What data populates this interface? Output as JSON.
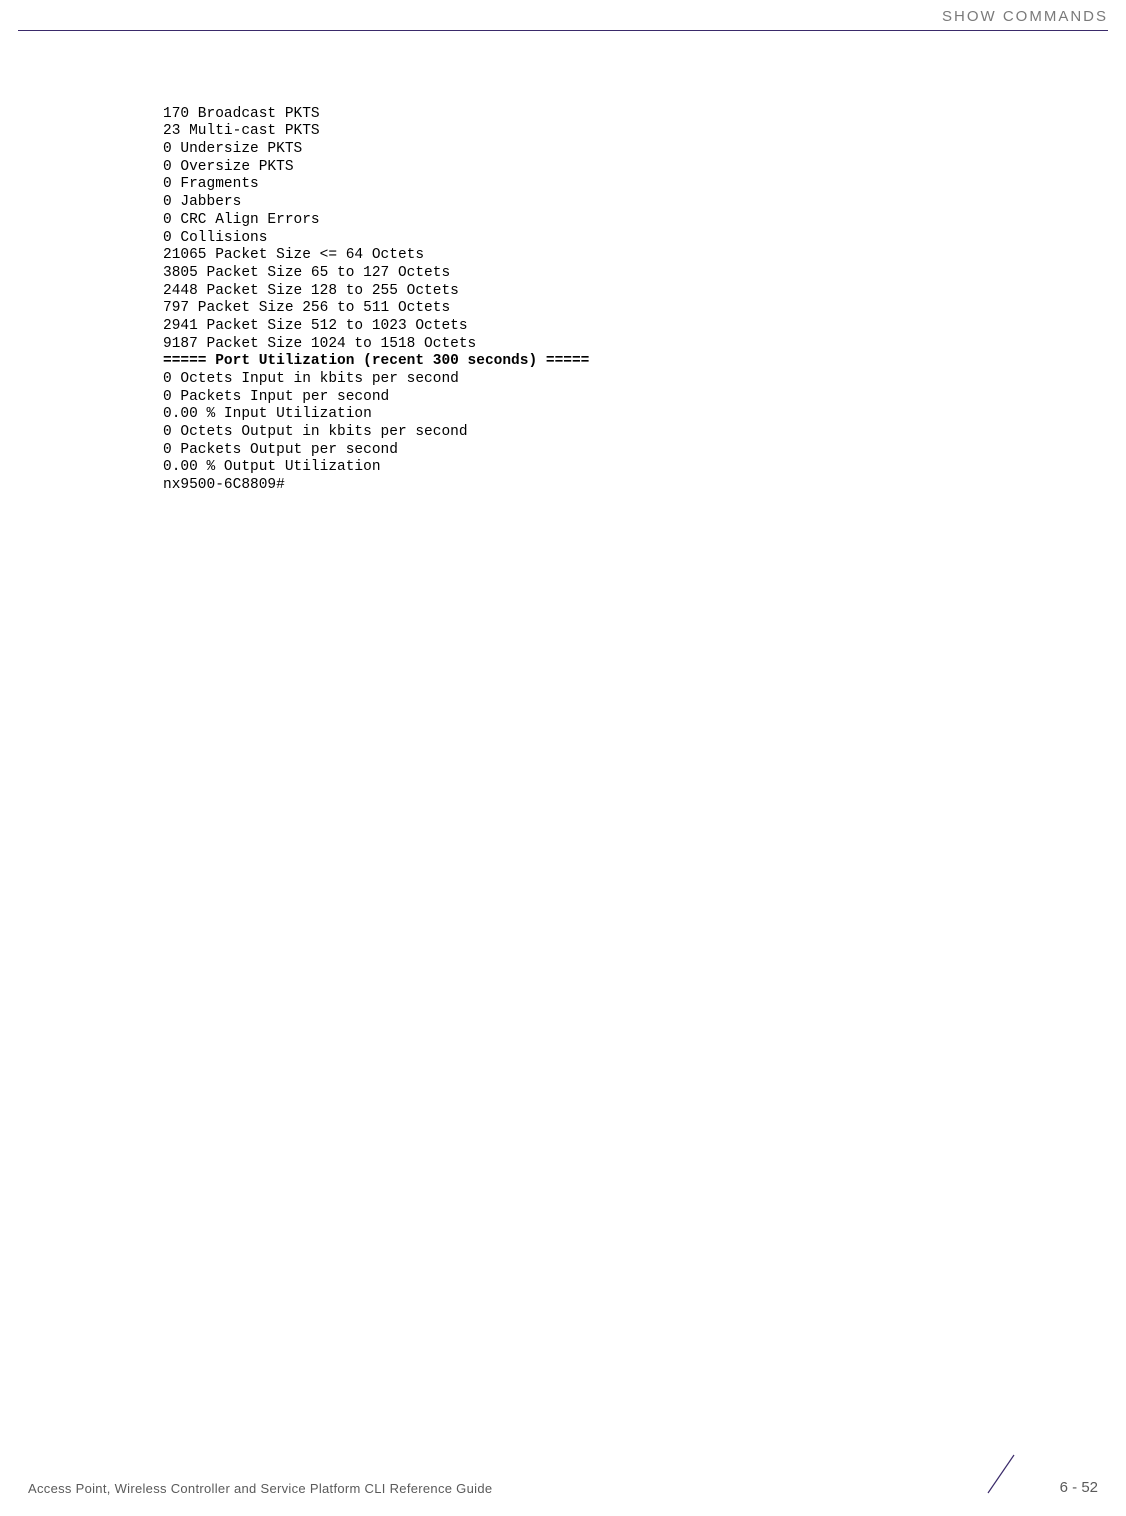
{
  "header": {
    "title": "SHOW COMMANDS"
  },
  "cli": {
    "lines": [
      "170 Broadcast PKTS",
      "23 Multi-cast PKTS",
      "0 Undersize PKTS",
      "0 Oversize PKTS",
      "0 Fragments",
      "0 Jabbers",
      "0 CRC Align Errors",
      "0 Collisions",
      "21065 Packet Size <= 64 Octets",
      "3805 Packet Size 65 to 127 Octets",
      "2448 Packet Size 128 to 255 Octets",
      "797 Packet Size 256 to 511 Octets",
      "2941 Packet Size 512 to 1023 Octets",
      "9187 Packet Size 1024 to 1518 Octets"
    ],
    "section_header": "===== Port Utilization (recent 300 seconds) =====",
    "lines2": [
      "0 Octets Input in kbits per second",
      "0 Packets Input per second",
      "0.00 % Input Utilization",
      "0 Octets Output in kbits per second",
      "0 Packets Output per second",
      "0.00 % Output Utilization",
      "nx9500-6C8809#"
    ]
  },
  "footer": {
    "text": "Access Point, Wireless Controller and Service Platform CLI Reference Guide",
    "page": "6 - 52"
  }
}
